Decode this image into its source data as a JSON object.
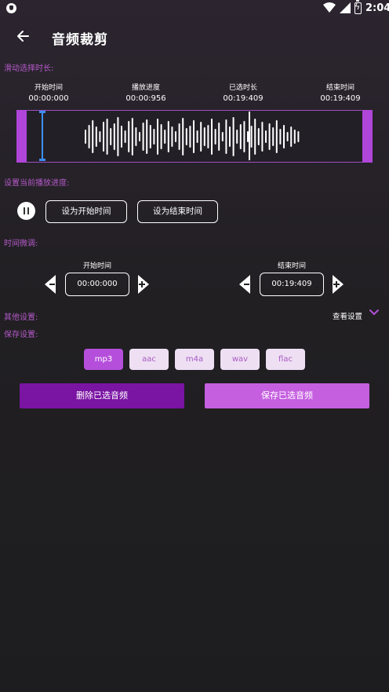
{
  "status": {
    "time": "2:04"
  },
  "header": {
    "title": "音频裁剪"
  },
  "slide_section": {
    "label": "滑动选择时长:",
    "times": [
      {
        "label": "开始时间",
        "value": "00:00:000"
      },
      {
        "label": "播放进度",
        "value": "00:00:956"
      },
      {
        "label": "已选时长",
        "value": "00:19:409"
      },
      {
        "label": "结束时间",
        "value": "00:19:409"
      }
    ]
  },
  "progress_section": {
    "label": "设置当前播放进度:",
    "set_start_label": "设为开始时间",
    "set_end_label": "设为结束时间"
  },
  "fine_tune": {
    "label": "时间微调:",
    "start": {
      "label": "开始时间",
      "value": "00:00:000"
    },
    "end": {
      "label": "结束时间",
      "value": "00:19:409"
    }
  },
  "other_settings": {
    "label": "其他设置:",
    "toggle_label": "查看设置"
  },
  "save_settings": {
    "label": "保存设置:",
    "formats": [
      "mp3",
      "aac",
      "m4a",
      "wav",
      "flac"
    ],
    "selected_format": "mp3"
  },
  "actions": {
    "delete_label": "删除已选音频",
    "save_label": "保存已选音频"
  },
  "colors": {
    "accent": "#b54fdb",
    "section_label": "#b45ac9",
    "delete_button": "#7a14a3",
    "save_button": "#c55fe0",
    "selection_cursor": "#3b8ff0"
  }
}
